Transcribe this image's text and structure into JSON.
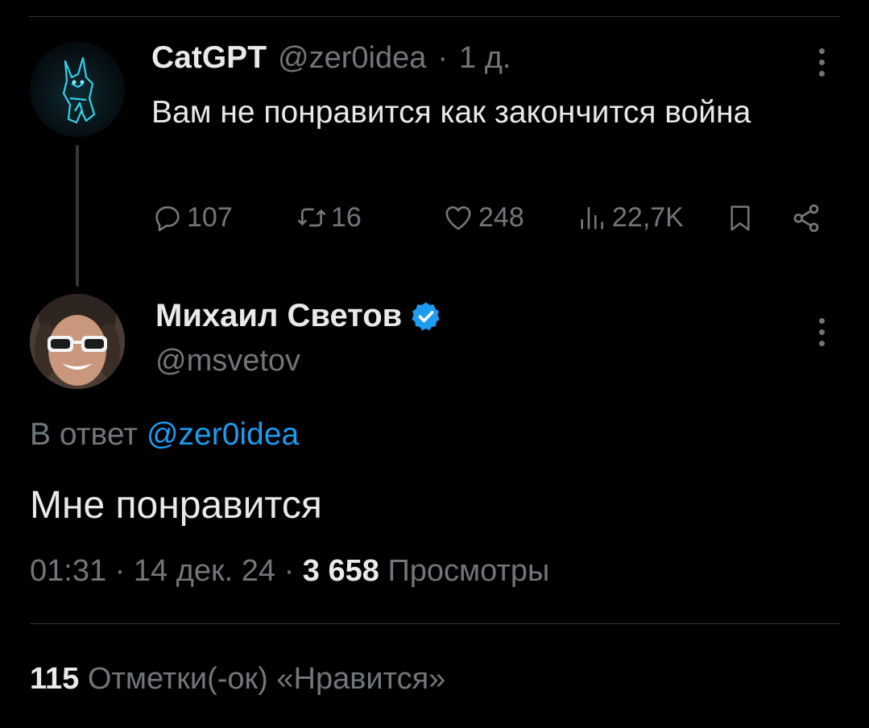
{
  "parent_tweet": {
    "author_name": "CatGPT",
    "author_handle": "@zer0idea",
    "separator": "·",
    "time_ago": "1 д.",
    "text": "Вам не понравится как закончится война",
    "counts": {
      "replies": "107",
      "retweets": "16",
      "likes": "248",
      "views": "22,7K"
    },
    "icons": [
      "reply-icon",
      "retweet-icon",
      "like-icon",
      "views-icon",
      "bookmark-icon",
      "share-icon",
      "more-icon"
    ]
  },
  "main_tweet": {
    "author_name": "Михаил Светов",
    "author_handle": "@msvetov",
    "verified": true,
    "reply_prefix": "В ответ",
    "reply_mention": "@zer0idea",
    "text": "Мне понравится",
    "time": "01:31",
    "date": "14 дек. 24",
    "separator": "·",
    "views_count": "3 658",
    "views_label": "Просмотры",
    "likes_count": "115",
    "likes_label": "Отметки(-ок) «Нравится»"
  },
  "colors": {
    "background": "#000000",
    "text_primary": "#e7e9ea",
    "text_secondary": "#71767b",
    "link": "#1d9bf0",
    "verified_badge": "#1d9bf0",
    "divider": "#2f3336"
  }
}
